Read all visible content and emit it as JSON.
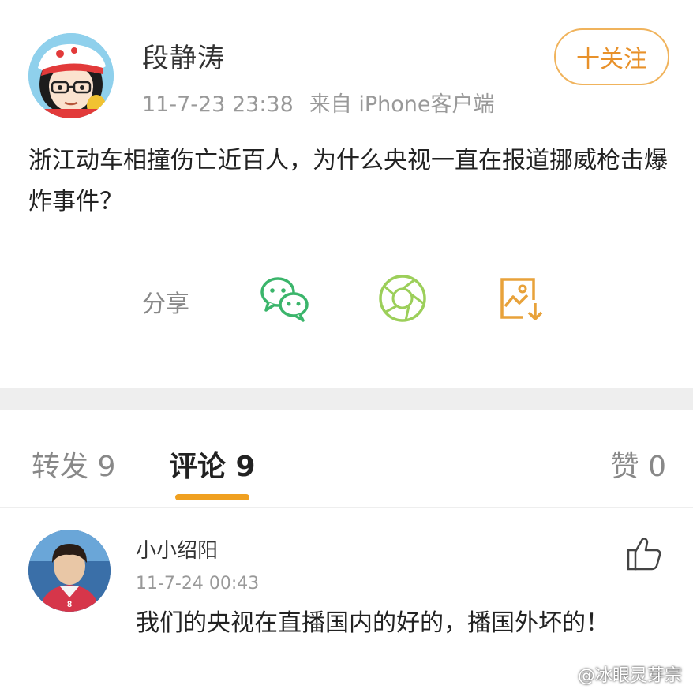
{
  "post": {
    "author": "段静涛",
    "time": "11-7-23 23:38",
    "source": "来自 iPhone客户端",
    "follow_label": "十关注",
    "text": "浙江动车相撞伤亡近百人，为什么央视一直在报道挪威枪击爆炸事件？",
    "share_label": "分享",
    "share_icons": [
      "wechat-icon",
      "moments-icon",
      "save-image-icon"
    ]
  },
  "tabs": {
    "repost": "转发 9",
    "comments": "评论 9",
    "likes": "赞 0",
    "active": "comments",
    "accent_color": "#f0a020"
  },
  "comment": {
    "name": "小小绍阳",
    "time": "11-7-24 00:43",
    "text": "我们的央视在直播国内的好的，播国外坏的！"
  },
  "watermark": "@冰眼灵芽宗"
}
